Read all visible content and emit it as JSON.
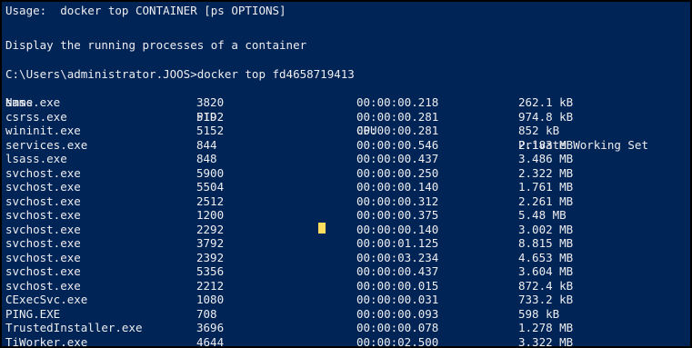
{
  "console": {
    "usage_line": "Usage:  docker top CONTAINER [ps OPTIONS]",
    "description_line": "Display the running processes of a container",
    "prompt_line": "C:\\Users\\administrator.JOOS>docker top fd4658719413"
  },
  "table": {
    "headers": [
      "Name",
      "PID",
      "CPU",
      "Private Working Set"
    ],
    "rows": [
      [
        "smss.exe",
        "3820",
        "00:00:00.218",
        "262.1 kB"
      ],
      [
        "csrss.exe",
        "5192",
        "00:00:00.281",
        "974.8 kB"
      ],
      [
        "wininit.exe",
        "5152",
        "00:00:00.281",
        "852 kB"
      ],
      [
        "services.exe",
        "844",
        "00:00:00.546",
        "2.183 MB"
      ],
      [
        "lsass.exe",
        "848",
        "00:00:00.437",
        "3.486 MB"
      ],
      [
        "svchost.exe",
        "5900",
        "00:00:00.250",
        "2.322 MB"
      ],
      [
        "svchost.exe",
        "5504",
        "00:00:00.140",
        "1.761 MB"
      ],
      [
        "svchost.exe",
        "2512",
        "00:00:00.312",
        "2.261 MB"
      ],
      [
        "svchost.exe",
        "1200",
        "00:00:00.375",
        "5.48 MB"
      ],
      [
        "svchost.exe",
        "2292",
        "00:00:00.140",
        "3.002 MB"
      ],
      [
        "svchost.exe",
        "3792",
        "00:00:01.125",
        "8.815 MB"
      ],
      [
        "svchost.exe",
        "2392",
        "00:00:03.234",
        "4.653 MB"
      ],
      [
        "svchost.exe",
        "5356",
        "00:00:00.437",
        "3.604 MB"
      ],
      [
        "svchost.exe",
        "2212",
        "00:00:00.015",
        "872.4 kB"
      ],
      [
        "CExecSvc.exe",
        "1080",
        "00:00:00.031",
        "733.2 kB"
      ],
      [
        "PING.EXE",
        "708",
        "00:00:00.093",
        "598 kB"
      ],
      [
        "TrustedInstaller.exe",
        "3696",
        "00:00:00.078",
        "1.278 MB"
      ],
      [
        "TiWorker.exe",
        "4644",
        "00:00:02.500",
        "3.322 MB"
      ]
    ]
  },
  "colors": {
    "console_background": "#012456",
    "console_text": "#eeedf0",
    "cursor": "#fede5d",
    "border": "#000000"
  }
}
